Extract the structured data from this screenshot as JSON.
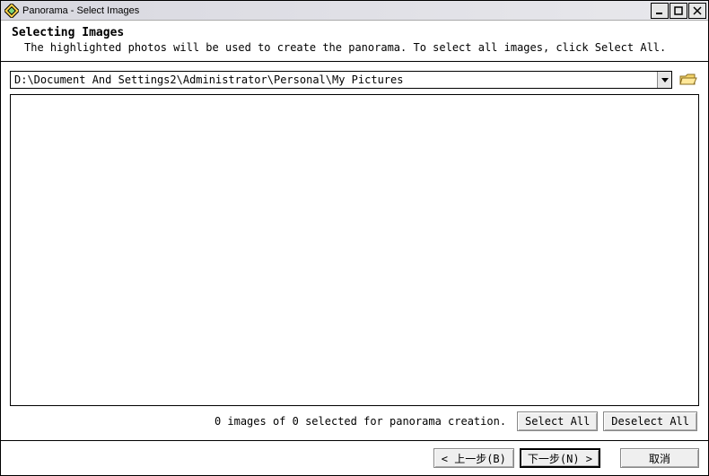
{
  "titlebar": {
    "title": "Panorama - Select Images"
  },
  "header": {
    "heading": "Selecting Images",
    "description": "The highlighted photos will be used to create the panorama. To select all images, click Select All."
  },
  "path": {
    "value": "D:\\Document And Settings2\\Administrator\\Personal\\My Pictures"
  },
  "status": {
    "text": "0 images of 0 selected for panorama creation."
  },
  "buttons": {
    "select_all": "Select All",
    "deselect_all": "Deselect All",
    "back": "< 上一步(B)",
    "next": "下一步(N) >",
    "cancel": "取消"
  }
}
